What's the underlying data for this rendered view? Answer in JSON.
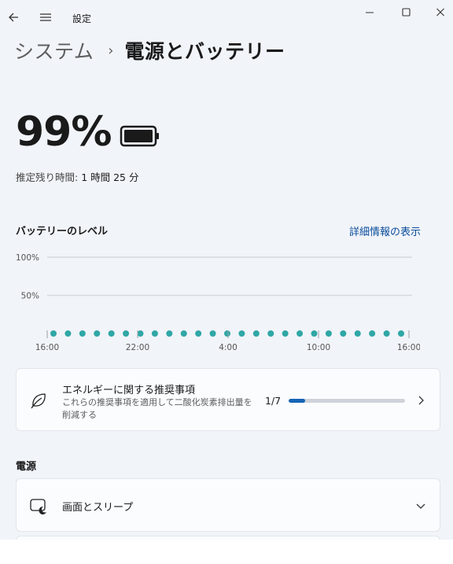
{
  "window": {
    "title": "設定"
  },
  "titlebar_icons": {
    "back": "back-arrow-icon",
    "menu": "hamburger-menu-icon",
    "minimize": "minimize-icon",
    "maximize": "maximize-icon",
    "close": "close-icon"
  },
  "breadcrumb": {
    "parent": "システム",
    "separator": "›",
    "current": "電源とバッテリー"
  },
  "battery": {
    "percent": "99%",
    "icon": "battery-full-icon",
    "remaining_label": "推定残り時間:",
    "remaining_value": "1 時間 25 分"
  },
  "level": {
    "title": "バッテリーのレベル",
    "details_link": "詳細情報の表示"
  },
  "chart_data": {
    "type": "scatter",
    "y_tick_labels": [
      "100%",
      "50%"
    ],
    "x_tick_labels": [
      "16:00",
      "22:00",
      "4:00",
      "10:00",
      "16:00"
    ],
    "ylim": [
      0,
      100
    ],
    "grid": true,
    "point_color": "#2fa7a6",
    "series": [
      {
        "values": [
          0,
          0,
          0,
          0,
          0,
          0,
          0,
          0,
          0,
          0,
          0,
          0,
          0,
          0,
          0,
          0,
          0,
          0,
          0,
          0,
          0,
          0,
          0,
          0,
          0
        ]
      }
    ]
  },
  "recommendation": {
    "icon": "leaf-icon",
    "title": "エネルギーに関する推奨事項",
    "description": "これらの推奨事項を適用して二酸化炭素排出量を削減する",
    "count": "1/7",
    "progress": 0.14,
    "chevron": "chevron-right-icon"
  },
  "power": {
    "section_title": "電源",
    "screen_sleep": {
      "icon": "screen-sleep-icon",
      "label": "画面とスリープ",
      "chevron": "chevron-down-icon"
    }
  },
  "colors": {
    "accent": "#1464b4",
    "link": "#0a4d9a",
    "chart_point": "#2fa7a6",
    "background": "#f1f4f9"
  }
}
